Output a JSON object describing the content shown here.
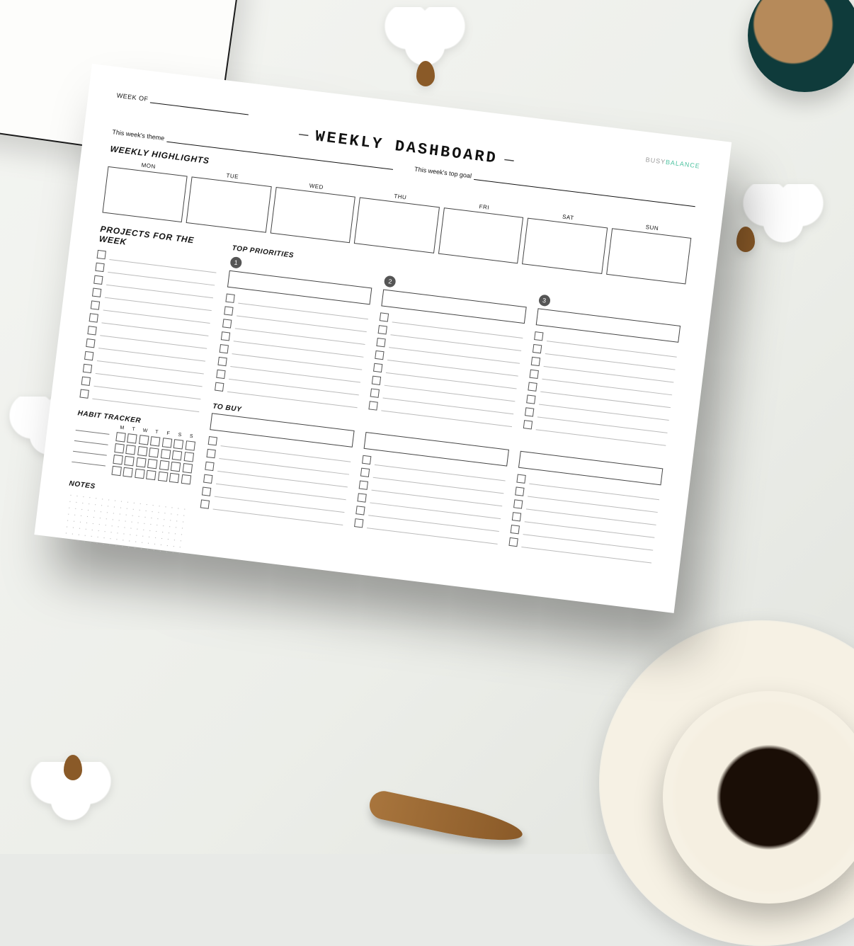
{
  "meta": {
    "week_of_label": "WEEK OF"
  },
  "title": "WEEKLY DASHBOARD",
  "logo": {
    "a": "BUSY",
    "b": "BALANCE"
  },
  "sublines": {
    "theme_label": "This week's theme",
    "goal_label": "This week's top goal"
  },
  "sections": {
    "highlights": "WEEKLY HIGHLIGHTS",
    "projects": "PROJECTS FOR THE WEEK",
    "priorities": "TOP PRIORITIES",
    "to_buy": "TO BUY",
    "habit": "HABIT TRACKER",
    "notes": "NOTES"
  },
  "days": [
    "MON",
    "TUE",
    "WED",
    "THU",
    "FRI",
    "SAT",
    "SUN"
  ],
  "habit_days": [
    "M",
    "T",
    "W",
    "T",
    "F",
    "S",
    "S"
  ],
  "priorities": [
    "1",
    "2",
    "3"
  ],
  "counts": {
    "project_lines": 12,
    "priority_lines": 8,
    "buy_lines": 6,
    "habit_name_lines": 4,
    "habit_weeks": 4
  }
}
